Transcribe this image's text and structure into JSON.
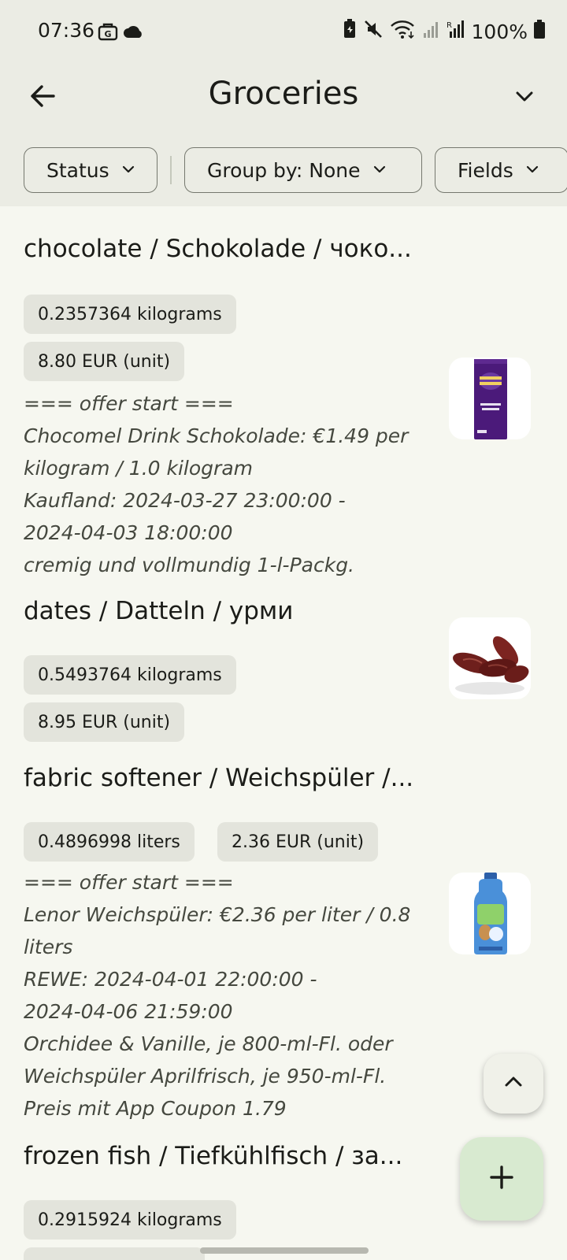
{
  "status_bar": {
    "time": "07:36",
    "battery": "100%",
    "icons": [
      "google-icon",
      "cloud-icon",
      "battery-saver-icon",
      "mute-icon",
      "wifi-icon",
      "signal-icon",
      "signal-r-icon",
      "battery-icon"
    ]
  },
  "appbar": {
    "title": "Groceries",
    "back_icon": "arrow-left-icon",
    "menu_icon": "chevron-down-icon"
  },
  "filters": {
    "status_label": "Status",
    "group_by_label": "Group by: None",
    "fields_label": "Fields"
  },
  "items": [
    {
      "name": "chocolate / Schokolade / чоко...",
      "tags": [
        "0.2357364 kilograms",
        "8.80 EUR (unit)"
      ],
      "offer_lines": [
        "=== offer start ===",
        "Chocomel Drink Schokolade: €1.49 per",
        "kilogram / 1.0 kilogram",
        "Kaufland: 2024-03-27 23:00:00 -",
        "2024-04-03 18:00:00",
        "cremig und vollmundig 1-l-Packg."
      ],
      "image": "chocolate-bar-image"
    },
    {
      "name": "dates / Datteln / урми",
      "tags": [
        "0.5493764 kilograms",
        "8.95 EUR (unit)"
      ],
      "offer_lines": [],
      "image": "dates-image"
    },
    {
      "name": "fabric softener / Weichspüler /...",
      "tags": [
        "0.4896998 liters",
        "2.36 EUR (unit)"
      ],
      "offer_lines": [
        "=== offer start ===",
        "Lenor Weichspüler: €2.36 per liter / 0.8",
        "liters",
        "REWE: 2024-04-01 22:00:00 -",
        "2024-04-06 21:59:00",
        "Orchidee & Vanille, je 800-ml-Fl. oder",
        "Weichspüler Aprilfrisch, je 950-ml-Fl.",
        "Preis mit App Coupon 1.79"
      ],
      "image": "fabric-softener-bottle-image"
    },
    {
      "name": "frozen fish / Tiefkühlfisch / за...",
      "tags": [
        "0.2915924 kilograms"
      ],
      "offer_lines": [],
      "image": ""
    }
  ],
  "fabs": {
    "scroll_top_icon": "chevron-up-icon",
    "add_icon": "plus-icon"
  },
  "colors": {
    "background": "#f6f7f0",
    "topbar": "#ebece4",
    "tag_bg": "#e3e4dc",
    "fab_add_bg": "#d8ead0",
    "chocolate_purple": "#4b1a7a",
    "dates_brown": "#6e1f1c",
    "softener_blue": "#4a90d9"
  }
}
